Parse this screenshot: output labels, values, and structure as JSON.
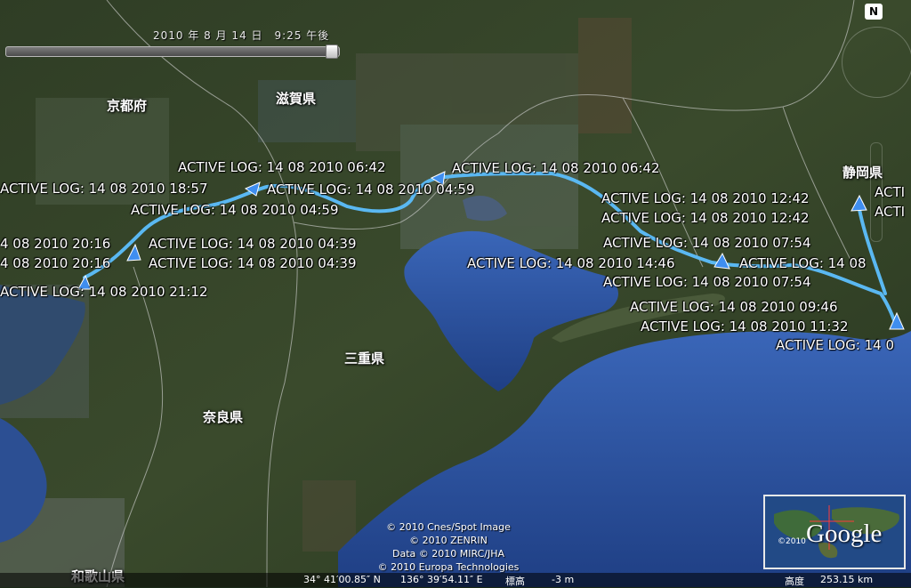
{
  "time_slider": {
    "datetime_text": "2010 年 8 月 14 日　9:25 午後"
  },
  "region_labels": [
    {
      "id": "kyoto",
      "text": "京都府"
    },
    {
      "id": "shiga",
      "text": "滋賀県"
    },
    {
      "id": "shizuoka",
      "text": "静岡県"
    },
    {
      "id": "mie",
      "text": "三重県"
    },
    {
      "id": "nara",
      "text": "奈良県"
    },
    {
      "id": "wakayama",
      "text": "和歌山県"
    }
  ],
  "track_labels": [
    "ACTIVE LOG: 14 08 2010 06:42",
    "ACTIVE LOG: 14 08 2010 06:42",
    "ACTIVE LOG: 14 08 2010 18:57",
    "ACTIVE LOG: 14 08 2010 04:59",
    "ACTIVE LOG: 14 08 2010 04:59",
    "ACTIVE LOG: 14 08 2010 12:42",
    "ACTIVE LOG: 14 08 2010 12:42",
    "ACTIVE LOG: 14 08 2010 07:54",
    "ACTIVE LOG: 14 08 2010 07:54",
    "ACTIVE LOG: 14 08 2010 14:46",
    "ACTIVE LOG: 14 08 2010 09:46",
    "ACTIVE LOG: 14 08 2010 11:32",
    "ACTIVE LOG: 14 0",
    "ACTIVE LOG: 14 08 2010 04:39",
    "ACTIVE LOG: 14 08 2010 04:39",
    "ACTIVE LOG: 14 08 2010 21:12",
    "4 08 2010 20:16",
    "4 08 2010 20:16",
    "ACTIVE LOG: 14 08",
    "ACTI",
    "ACTI"
  ],
  "credits": [
    "© 2010 Cnes/Spot Image",
    "© 2010 ZENRIN",
    "Data © 2010 MIRC/JHA",
    "© 2010 Europa Technologies"
  ],
  "status_bar": {
    "latitude": "34° 41′00.85″ N",
    "longitude": "136° 39′54.11″ E",
    "elevation_label": "標高",
    "elevation_value": "-3 m",
    "altitude_label": "高度",
    "altitude_value": "253.15 km"
  },
  "overview_map": {
    "logo_text": "Google",
    "copyright": "©2010"
  },
  "navigation": {
    "north_label": "N"
  },
  "colors": {
    "track": "#5ab8f2",
    "sea": "#2a4d92",
    "land": "#2e3d24"
  }
}
